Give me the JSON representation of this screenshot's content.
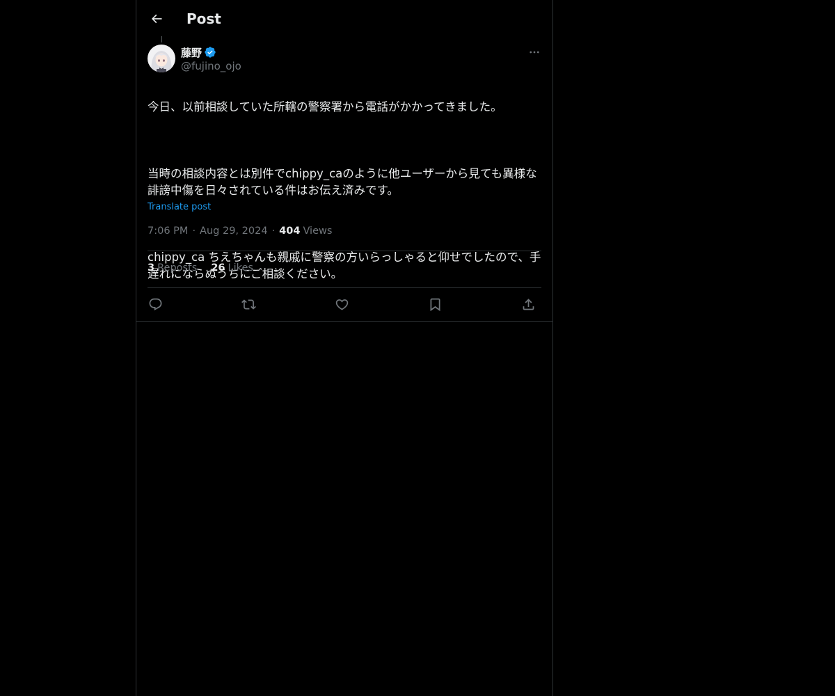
{
  "header": {
    "title": "Post",
    "back_icon": "arrow-left-icon"
  },
  "author": {
    "display_name": "藤野",
    "handle": "@fujino_ojo",
    "verified_icon": "verified-badge-icon",
    "verified_color": "#1d9bf0"
  },
  "post": {
    "text_line_1": "今日、以前相談していた所轄の警察署から電話がかかってきました。",
    "text_line_2": "当時の相談内容とは別件でchippy_caのように他ユーザーから見ても異様な誹謗中傷を日々されている件はお伝え済みです。",
    "text_line_3": "chippy_ca ちえちゃんも親戚に警察の方いらっしゃると仰せでしたので、手遅れにならぬうちにご相談ください。",
    "translate_label": "Translate post",
    "time": "7:06 PM",
    "date": "Aug 29, 2024",
    "separator": "·",
    "views_count": "404",
    "views_label": "Views"
  },
  "stats": {
    "reposts_count": "3",
    "reposts_label": "Reposts",
    "likes_count": "26",
    "likes_label": "Likes"
  },
  "actions": [
    {
      "name": "reply",
      "icon": "reply-icon"
    },
    {
      "name": "repost",
      "icon": "repost-icon"
    },
    {
      "name": "like",
      "icon": "heart-icon"
    },
    {
      "name": "bookmark",
      "icon": "bookmark-icon"
    },
    {
      "name": "share",
      "icon": "share-icon"
    }
  ],
  "colors": {
    "background": "#000000",
    "text_primary": "#e7e9ea",
    "text_secondary": "#71767b",
    "border": "#2f3336",
    "accent": "#1d9bf0"
  }
}
